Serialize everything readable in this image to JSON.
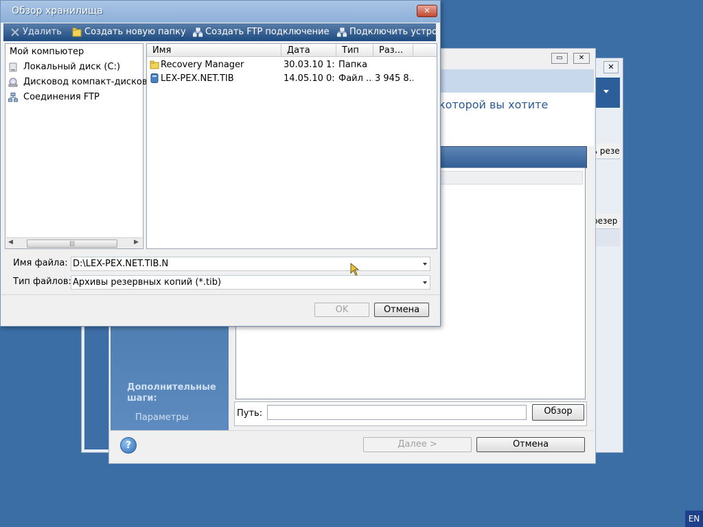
{
  "dialog": {
    "title": "Обзор хранилища",
    "close_glyph": "✕",
    "toolbar": [
      {
        "label": "Удалить",
        "icon": "delete-icon"
      },
      {
        "label": "Создать новую папку",
        "icon": "new-folder-icon"
      },
      {
        "label": "Создать FTP подключение",
        "icon": "network-icon"
      },
      {
        "label": "Подключить устрой",
        "icon": "network-icon"
      }
    ],
    "tree": {
      "root": "Мой компьютер",
      "items": [
        {
          "label": "Локальный диск (C:)",
          "icon": "disk-icon"
        },
        {
          "label": "Дисковод компакт-дисков",
          "icon": "cd-drive-icon"
        },
        {
          "label": "Соединения FTP",
          "icon": "ftp-icon"
        }
      ]
    },
    "files": {
      "columns": [
        "Имя",
        "Дата",
        "Тип",
        "Раз..."
      ],
      "rows": [
        {
          "name": "Recovery Manager",
          "date": "30.03.10 1:...",
          "type": "Папка",
          "size": "",
          "icon": "folder-icon"
        },
        {
          "name": "LEX-PEX.NET.TIB",
          "date": "14.05.10 0:...",
          "type": "Файл ...",
          "size": "3 945 8...",
          "icon": "archive-file-icon"
        }
      ]
    },
    "filename_label": "Имя файла:",
    "filename_value": "D:\\LEX-PEX.NET.TIB.N",
    "filetype_label": "Тип файлов:",
    "filetype_value": "Архивы резервных копий (*.tib)",
    "ok_label": "OK",
    "cancel_label": "Отмена"
  },
  "wizard": {
    "question_fragment": "которой вы хотите",
    "sidebar_title": "Дополнительные шаги:",
    "sidebar_item": "Параметры",
    "path_label": "Путь:",
    "path_value": "",
    "browse_label": "Обзор",
    "next_label": "Далее >",
    "cancel_label": "Отмена"
  },
  "back_window": {
    "tab_text_1": "ь резе",
    "tab_text_2": "резер"
  },
  "taskbar": {
    "language": "EN"
  },
  "colors": {
    "desktop": "#3a6ea5",
    "toolbar": "#1d4a80",
    "title": "#8eb0d9"
  }
}
